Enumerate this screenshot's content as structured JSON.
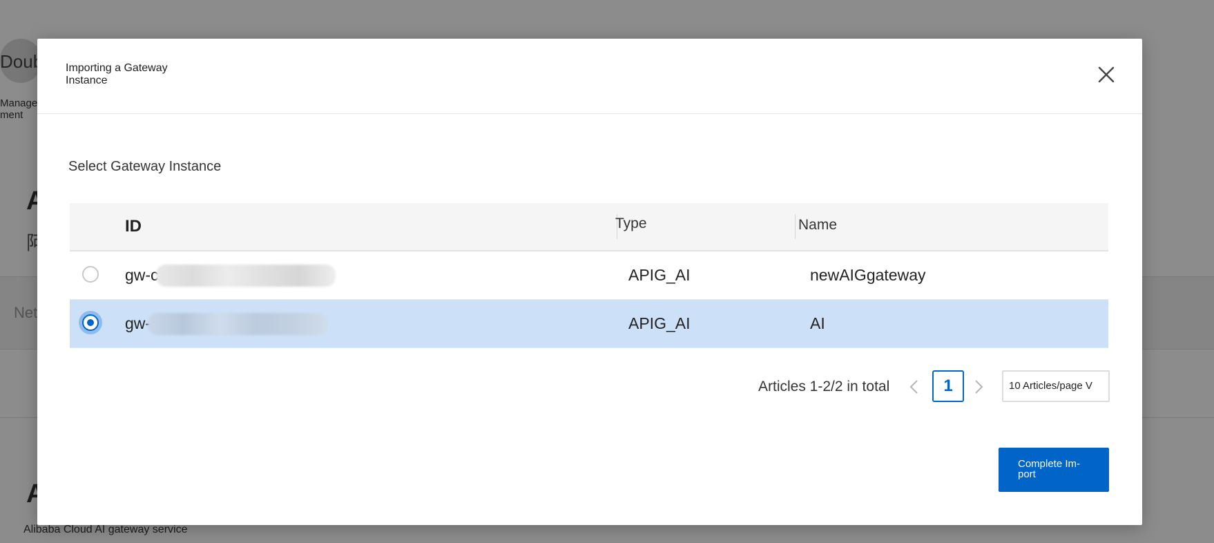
{
  "background": {
    "app_name": "Double",
    "menu_label": "Manage-\nment",
    "heading_a": "A",
    "subheading_a": "阿",
    "input_hint": "Net",
    "heading_b": "A",
    "footer_text": "Alibaba Cloud AI gateway service"
  },
  "modal": {
    "title": "Importing a Gateway Instance",
    "close_icon": "close-icon",
    "section_label": "Select Gateway Instance",
    "table": {
      "columns": [
        "ID",
        "Type",
        "Name"
      ],
      "rows": [
        {
          "id": "gw-c",
          "type": "APIG_AI",
          "name": "newAIGgateway",
          "selected": false
        },
        {
          "id": "gw-",
          "type": "APIG_AI",
          "name": "AI",
          "selected": true
        }
      ]
    },
    "pagination": {
      "total_text": "Articles 1-2/2 in total",
      "current_page": "1",
      "page_size": "10 Articles/page V"
    },
    "complete_button": "Complete Im-\nport"
  },
  "colors": {
    "primary": "#0064c8",
    "selected_row": "#cce0f7",
    "overlay": "rgba(0,0,0,0.45)"
  }
}
